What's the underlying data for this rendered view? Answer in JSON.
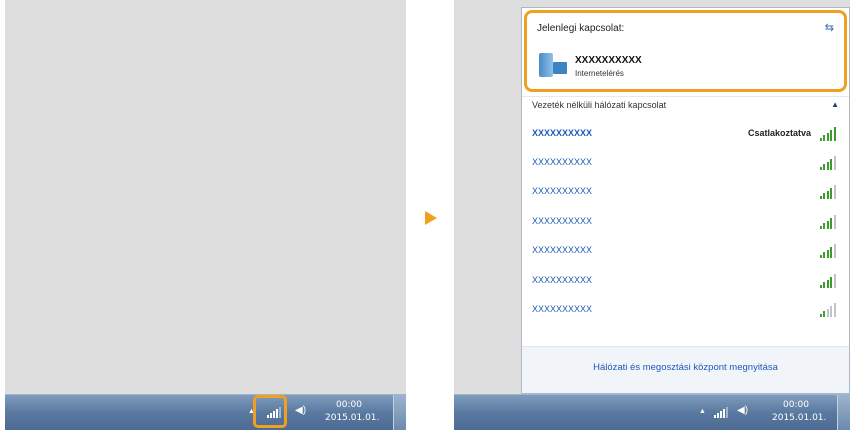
{
  "taskbar": {
    "time": "00:00",
    "date": "2015.01.01."
  },
  "popup": {
    "current_connection_title": "Jelenlegi kapcsolat:",
    "current_network_name": "XXXXXXXXXX",
    "current_network_status": "Internetelérés",
    "wireless_section_title": "Vezeték nélküli hálózati kapcsolat",
    "networks": [
      {
        "name": "XXXXXXXXXX",
        "status": "Csatlakoztatva",
        "signal": 5
      },
      {
        "name": "XXXXXXXXXX",
        "status": "",
        "signal": 4
      },
      {
        "name": "XXXXXXXXXX",
        "status": "",
        "signal": 4
      },
      {
        "name": "XXXXXXXXXX",
        "status": "",
        "signal": 4
      },
      {
        "name": "XXXXXXXXXX",
        "status": "",
        "signal": 4
      },
      {
        "name": "XXXXXXXXXX",
        "status": "",
        "signal": 4
      },
      {
        "name": "XXXXXXXXXX",
        "status": "",
        "signal": 2
      }
    ],
    "footer_link": "Hálózati és megosztási központ megnyitása"
  },
  "colors": {
    "highlight": "#f0a020",
    "link": "#1c5bb7",
    "signal_on": "#3e9b2e"
  }
}
